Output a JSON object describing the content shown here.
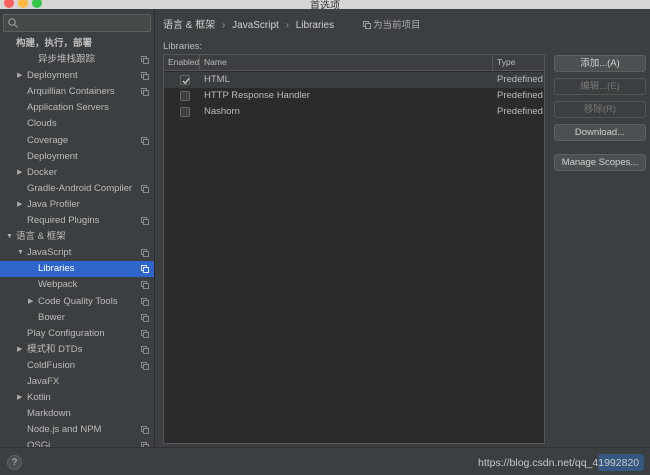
{
  "window": {
    "title": "首选项"
  },
  "search": {
    "placeholder": ""
  },
  "sidebar": {
    "items": [
      {
        "label": "构建，执行，部署",
        "depth": 0,
        "arrow": "",
        "copy": false,
        "bold": true
      },
      {
        "label": "异步堆栈跟踪",
        "depth": 2,
        "arrow": "",
        "copy": true
      },
      {
        "label": "Deployment",
        "depth": 1,
        "arrow": "▶",
        "copy": true
      },
      {
        "label": "Arquillian Containers",
        "depth": 1,
        "arrow": "",
        "copy": true
      },
      {
        "label": "Application Servers",
        "depth": 1,
        "arrow": "",
        "copy": false
      },
      {
        "label": "Clouds",
        "depth": 1,
        "arrow": "",
        "copy": false
      },
      {
        "label": "Coverage",
        "depth": 1,
        "arrow": "",
        "copy": true
      },
      {
        "label": "Deployment",
        "depth": 1,
        "arrow": "",
        "copy": false
      },
      {
        "label": "Docker",
        "depth": 1,
        "arrow": "▶",
        "copy": false
      },
      {
        "label": "Gradle-Android Compiler",
        "depth": 1,
        "arrow": "",
        "copy": true
      },
      {
        "label": "Java Profiler",
        "depth": 1,
        "arrow": "▶",
        "copy": false
      },
      {
        "label": "Required Plugins",
        "depth": 1,
        "arrow": "",
        "copy": true
      },
      {
        "label": "语言 & 框架",
        "depth": 0,
        "arrow": "▼",
        "copy": false
      },
      {
        "label": "JavaScript",
        "depth": 1,
        "arrow": "▼",
        "copy": true
      },
      {
        "label": "Libraries",
        "depth": 2,
        "arrow": "",
        "copy": true,
        "selected": true
      },
      {
        "label": "Webpack",
        "depth": 2,
        "arrow": "",
        "copy": true
      },
      {
        "label": "Code Quality Tools",
        "depth": 2,
        "arrow": "▶",
        "copy": true
      },
      {
        "label": "Bower",
        "depth": 2,
        "arrow": "",
        "copy": true
      },
      {
        "label": "Play Configuration",
        "depth": 1,
        "arrow": "",
        "copy": true
      },
      {
        "label": "模式和 DTDs",
        "depth": 1,
        "arrow": "▶",
        "copy": true
      },
      {
        "label": "ColdFusion",
        "depth": 1,
        "arrow": "",
        "copy": true
      },
      {
        "label": "JavaFX",
        "depth": 1,
        "arrow": "",
        "copy": false
      },
      {
        "label": "Kotlin",
        "depth": 1,
        "arrow": "▶",
        "copy": false
      },
      {
        "label": "Markdown",
        "depth": 1,
        "arrow": "",
        "copy": false
      },
      {
        "label": "Node.js and NPM",
        "depth": 1,
        "arrow": "",
        "copy": true
      },
      {
        "label": "OSGi",
        "depth": 1,
        "arrow": "",
        "copy": true
      }
    ]
  },
  "breadcrumb": {
    "items": [
      "语言 & 框架",
      "JavaScript",
      "Libraries"
    ],
    "separator": "›"
  },
  "project_scope": {
    "label": "为当前项目"
  },
  "libraries": {
    "title": "Libraries:",
    "columns": {
      "enabled": "Enabled",
      "name": "Name",
      "type": "Type"
    },
    "rows": [
      {
        "enabled": true,
        "name": "HTML",
        "type": "Predefined"
      },
      {
        "enabled": false,
        "name": "HTTP Response Handler",
        "type": "Predefined"
      },
      {
        "enabled": false,
        "name": "Nashorn",
        "type": "Predefined"
      }
    ]
  },
  "buttons": {
    "add": "添加...(A)",
    "edit": "编辑...(E)",
    "remove": "移除(R)",
    "download": "Download...",
    "manage_scopes": "Manage Scopes..."
  },
  "footer": {
    "help": "?",
    "watermark": "https://blog.csdn.net/qq_41992820"
  },
  "colors": {
    "selection": "#2f65ca",
    "background": "#3c3f41",
    "table_bg": "#2b2b2b"
  },
  "icons": {
    "search": "search-icon",
    "copy": "copy-scope-icon",
    "help": "help-icon"
  }
}
